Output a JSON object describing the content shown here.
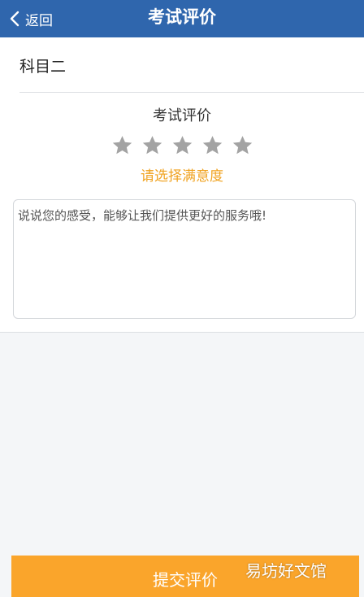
{
  "header": {
    "back_label": "返回",
    "title": "考试评价"
  },
  "subject": {
    "name": "科目二"
  },
  "rating": {
    "title": "考试评价",
    "hint": "请选择满意度",
    "stars": [
      {
        "icon": "star-icon",
        "filled": false
      },
      {
        "icon": "star-icon",
        "filled": false
      },
      {
        "icon": "star-icon",
        "filled": false
      },
      {
        "icon": "star-icon",
        "filled": false
      },
      {
        "icon": "star-icon",
        "filled": false
      }
    ],
    "selected_count": 0
  },
  "comment": {
    "placeholder": "说说您的感受，能够让我们提供更好的服务哦!",
    "value": ""
  },
  "submit": {
    "label": "提交评价"
  },
  "watermark": {
    "text": "易坊好文馆"
  },
  "colors": {
    "header_bg": "#2f66ad",
    "accent": "#f0a21f",
    "submit_bg": "#faa52b",
    "star_empty": "#a3a3a3"
  }
}
